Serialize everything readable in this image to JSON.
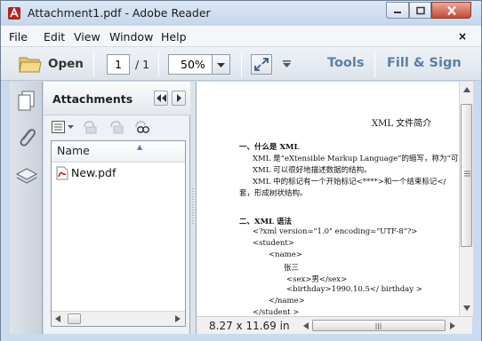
{
  "window": {
    "title": "Attachment1.pdf - Adobe Reader"
  },
  "menu": {
    "items": [
      "File",
      "Edit",
      "View",
      "Window",
      "Help"
    ],
    "close_glyph": "×"
  },
  "toolbar": {
    "open_label": "Open",
    "page_current": "1",
    "page_total": "/ 1",
    "zoom_value": "50%",
    "tools_label": "Tools",
    "fill_sign_label": "Fill & Sign"
  },
  "nav_panel": {
    "icons": [
      "pages-icon",
      "attachments-paperclip-icon",
      "layers-icon"
    ]
  },
  "attachments_panel": {
    "title": "Attachments",
    "column_header": "Name",
    "files": [
      {
        "name": "New.pdf",
        "icon": "pdf-file-icon"
      }
    ]
  },
  "document": {
    "title": "XML 文件简介",
    "section1_heading": "一、什么是 XML",
    "section1_lines": [
      "XML 是“eXtensible Markup Language”的缩写，称为“可",
      "XML 可以很好地描述数据的结构。",
      "XML 中的标记有一个开始标记<****>和一个结束标记</",
      "套，形成树状结构。"
    ],
    "section2_heading": "二、XML 语法",
    "code_lines": [
      "<?xml version=\"1.0\"    encoding=\"UTF-8\"?>",
      "<student>",
      "<name>",
      "张三",
      "<sex>男</sex>",
      "<birthday>1990.10.5</ birthday >",
      "</name>",
      "</student >"
    ]
  },
  "status": {
    "page_size": "8.27 x 11.69 in"
  },
  "colors": {
    "accent_blue": "#5a7ea6",
    "frame": "#c9dbef",
    "close_red": "#c44a33"
  }
}
